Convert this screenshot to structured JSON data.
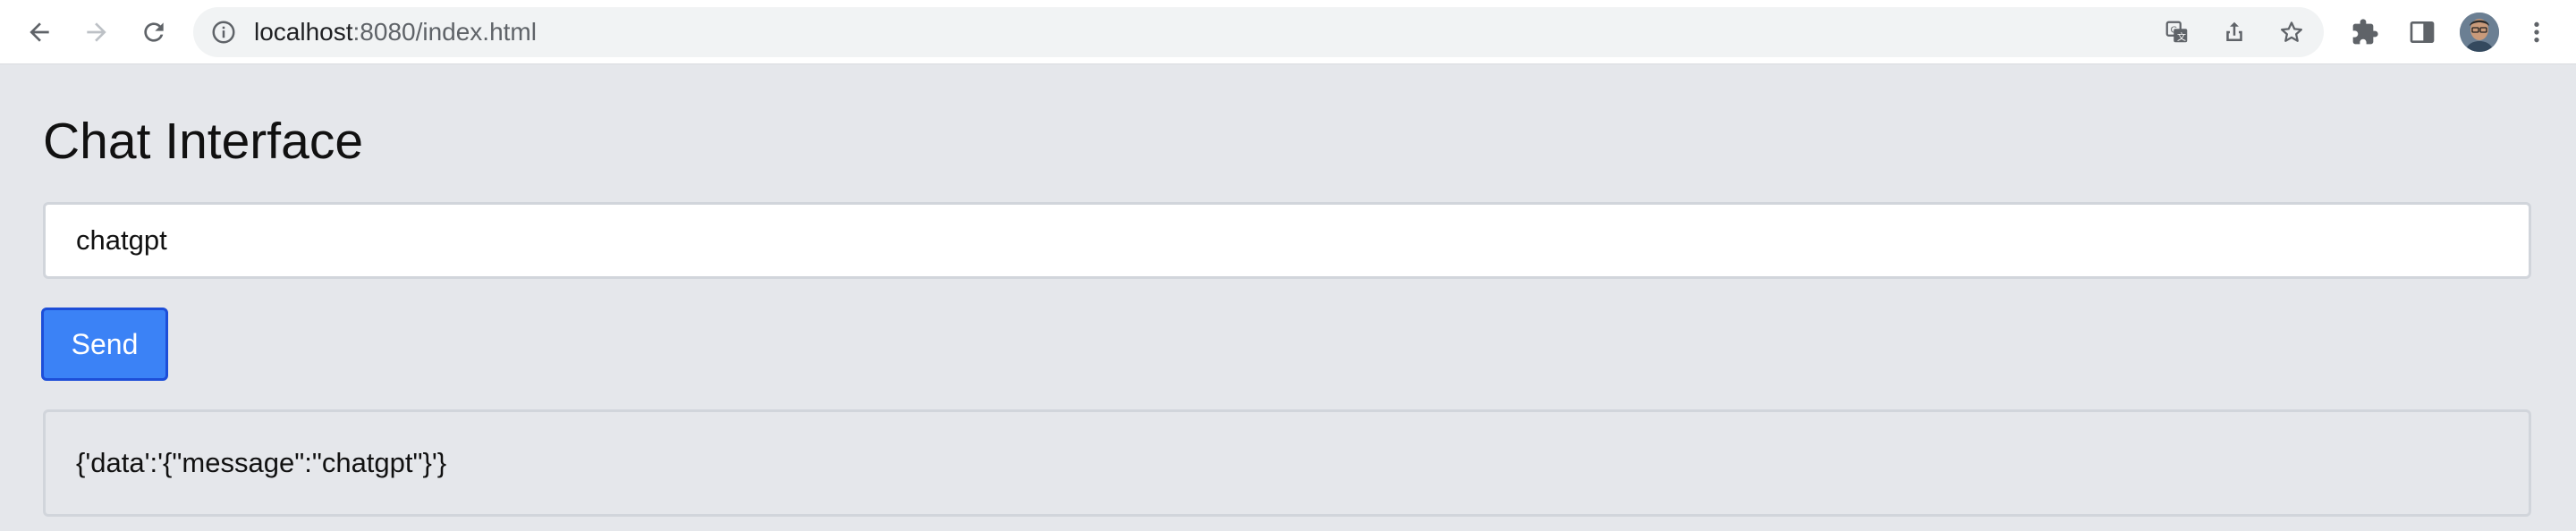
{
  "browser": {
    "url_host": "localhost",
    "url_path": ":8080/index.html",
    "icons": {
      "back": "back-arrow-icon",
      "forward": "forward-arrow-icon",
      "reload": "reload-icon",
      "site_info": "info-icon",
      "translate": "translate-icon",
      "share": "share-icon",
      "bookmark": "star-icon",
      "extensions": "puzzle-icon",
      "side_panel": "side-panel-icon",
      "profile": "avatar",
      "menu": "kebab-menu-icon"
    }
  },
  "page": {
    "title": "Chat Interface",
    "input_value": "chatgpt",
    "send_label": "Send",
    "response": "{'data':'{\"message\":\"chatgpt\"}'}"
  },
  "colors": {
    "page_background": "#e5e7eb",
    "button_primary": "#3b82f6",
    "button_border": "#1d4ed8",
    "input_border": "#d1d5db"
  }
}
